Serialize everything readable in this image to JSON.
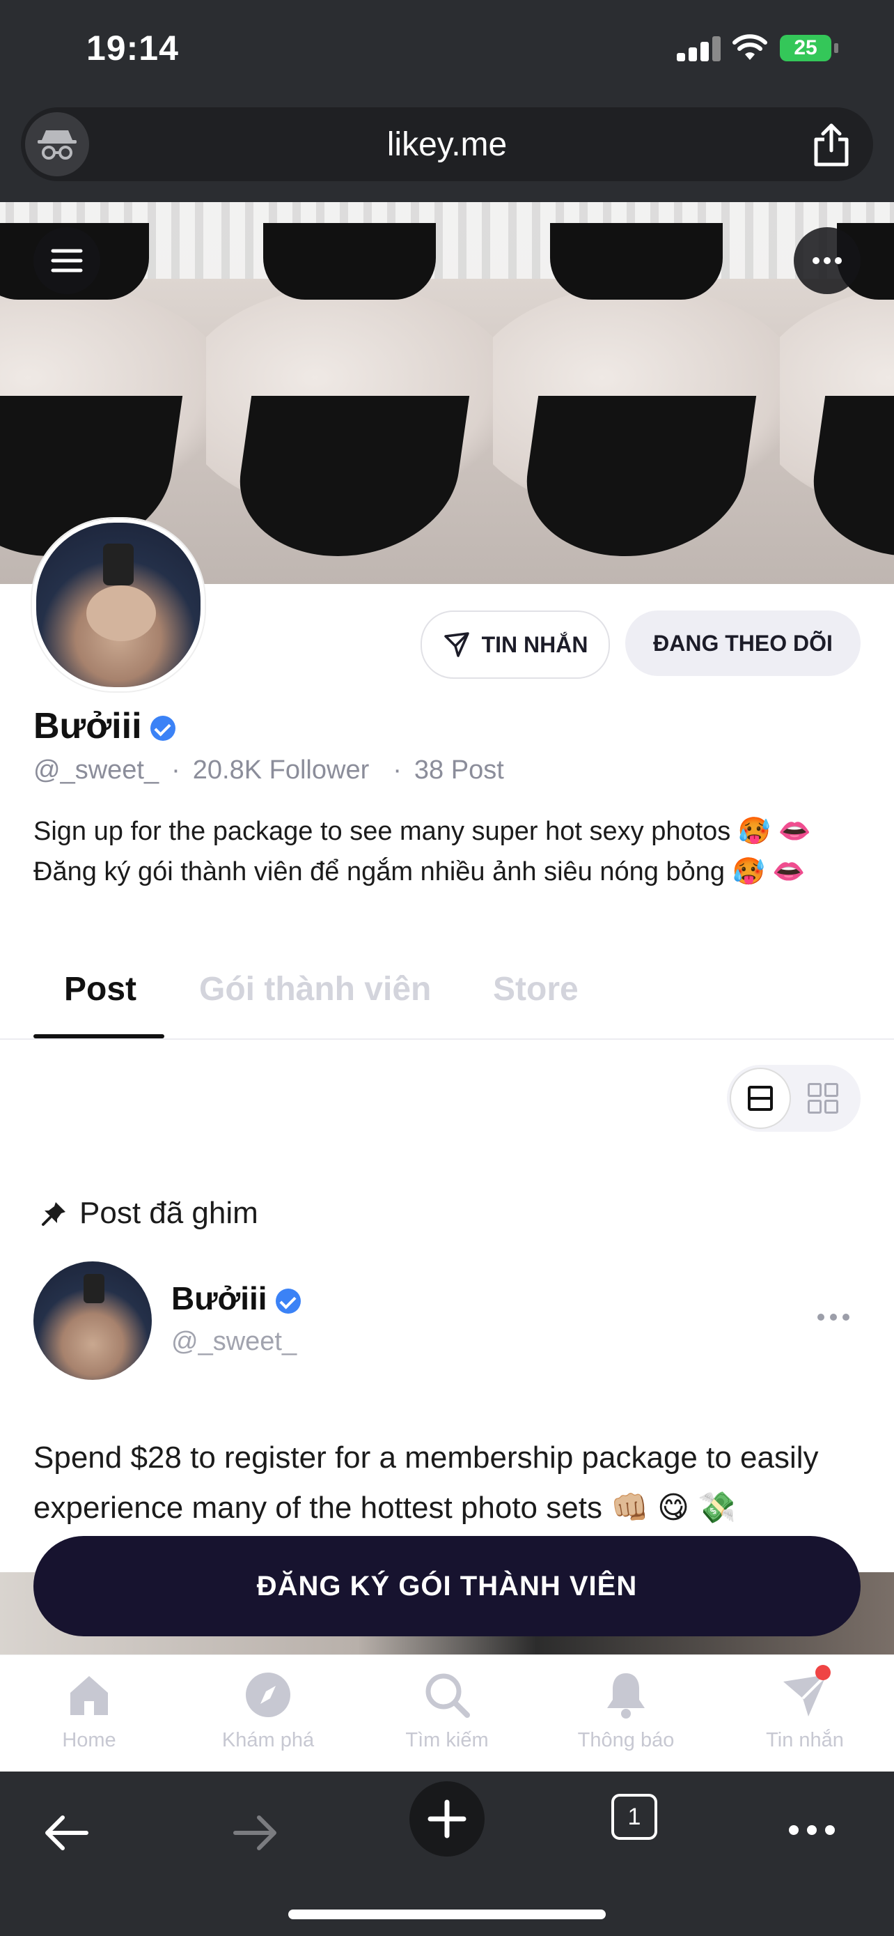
{
  "status": {
    "time": "19:14",
    "battery": "25"
  },
  "browser": {
    "url": "likey.me",
    "tab_count": "1"
  },
  "profile": {
    "name": "Bưởiii",
    "handle": "@_sweet_",
    "followers": "20.8K Follower",
    "posts": "38 Post",
    "bio_line1": "Sign up for the package to see many super hot sexy photos 🥵 👄",
    "bio_line2": "Đăng ký gói thành viên để ngắm nhiều ảnh siêu nóng bỏng 🥵 👄",
    "message_button": "TIN NHẮN",
    "follow_button": "ĐANG THEO DÕI"
  },
  "tabs": [
    {
      "label": "Post",
      "active": true
    },
    {
      "label": "Gói thành viên",
      "active": false
    },
    {
      "label": "Store",
      "active": false
    }
  ],
  "pinned_label": "Post đã ghim",
  "post": {
    "author": "Bưởiii",
    "handle": "@_sweet_",
    "text": "Spend $28 to register for a membership package to easily experience many of the hottest photo sets 👊🏼 😋 💸"
  },
  "cta_label": "ĐĂNG KÝ GÓI THÀNH VIÊN",
  "appnav": [
    {
      "label": "Home",
      "icon": "home-icon"
    },
    {
      "label": "Khám phá",
      "icon": "compass-icon"
    },
    {
      "label": "Tìm kiếm",
      "icon": "search-icon"
    },
    {
      "label": "Thông báo",
      "icon": "bell-icon"
    },
    {
      "label": "Tin nhắn",
      "icon": "send-icon"
    }
  ],
  "colors": {
    "accent": "#17132f",
    "verified": "#3b82f6",
    "inactive": "#c7c8d2",
    "chrome": "#2b2d31"
  }
}
